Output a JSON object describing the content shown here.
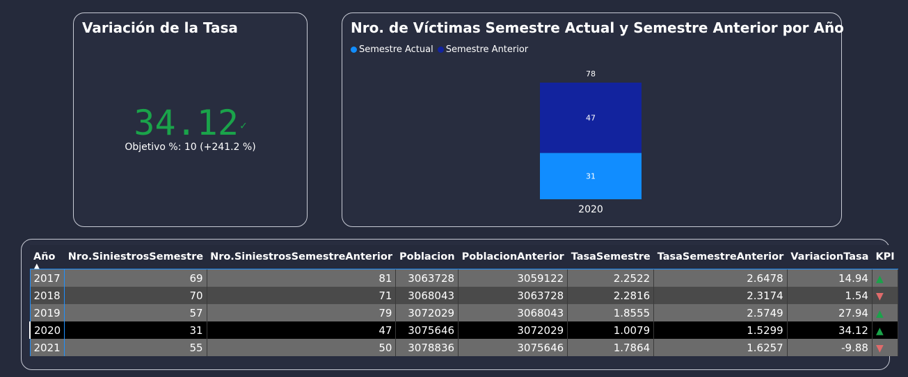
{
  "kpi": {
    "title": "Variación de la Tasa",
    "value": "34.12",
    "check": "✓",
    "goal": "Objetivo %: 10 (+241.2 %)",
    "value_color": "#1aa34a"
  },
  "chart": {
    "title": "Nro. de Víctimas Semestre Actual y Semestre Anterior por Año",
    "legend": [
      {
        "label": "Semestre Actual",
        "color": "#118dff"
      },
      {
        "label": "Semestre Anterior",
        "color": "#12239e"
      }
    ]
  },
  "chart_data": {
    "type": "bar",
    "stacked": true,
    "categories": [
      "2020"
    ],
    "series": [
      {
        "name": "Semestre Actual",
        "values": [
          31
        ],
        "color": "#118dff"
      },
      {
        "name": "Semestre Anterior",
        "values": [
          47
        ],
        "color": "#12239e"
      }
    ],
    "totals": [
      78
    ],
    "title": "Nro. de Víctimas Semestre Actual y Semestre Anterior por Año",
    "xlabel": "",
    "ylabel": "",
    "ylim": [
      0,
      78
    ],
    "grid": false,
    "legend_position": "top-left"
  },
  "table": {
    "columns": [
      "Año",
      "Nro.SiniestrosSemestre",
      "Nro.SiniestrosSemestreAnterior",
      "Poblacion",
      "PoblacionAnterior",
      "TasaSemestre",
      "TasaSemestreAnterior",
      "VariacionTasa",
      "KPI"
    ],
    "sort_indicator": "▲",
    "rows": [
      {
        "anio": "2017",
        "sin": "69",
        "sin_ant": "81",
        "pob": "3063728",
        "pob_ant": "3059122",
        "tasa": "2.2522",
        "tasa_ant": "2.6478",
        "var": "14.94",
        "kpi": "▲",
        "kpi_dir": "up"
      },
      {
        "anio": "2018",
        "sin": "70",
        "sin_ant": "71",
        "pob": "3068043",
        "pob_ant": "3063728",
        "tasa": "2.2816",
        "tasa_ant": "2.3174",
        "var": "1.54",
        "kpi": "▼",
        "kpi_dir": "down"
      },
      {
        "anio": "2019",
        "sin": "57",
        "sin_ant": "79",
        "pob": "3072029",
        "pob_ant": "3068043",
        "tasa": "1.8555",
        "tasa_ant": "2.5749",
        "var": "27.94",
        "kpi": "▲",
        "kpi_dir": "up"
      },
      {
        "anio": "2020",
        "sin": "31",
        "sin_ant": "47",
        "pob": "3075646",
        "pob_ant": "3072029",
        "tasa": "1.0079",
        "tasa_ant": "1.5299",
        "var": "34.12",
        "kpi": "▲",
        "kpi_dir": "up"
      },
      {
        "anio": "2021",
        "sin": "55",
        "sin_ant": "50",
        "pob": "3078836",
        "pob_ant": "3075646",
        "tasa": "1.7864",
        "tasa_ant": "1.6257",
        "var": "-9.88",
        "kpi": "▼",
        "kpi_dir": "down"
      }
    ]
  }
}
